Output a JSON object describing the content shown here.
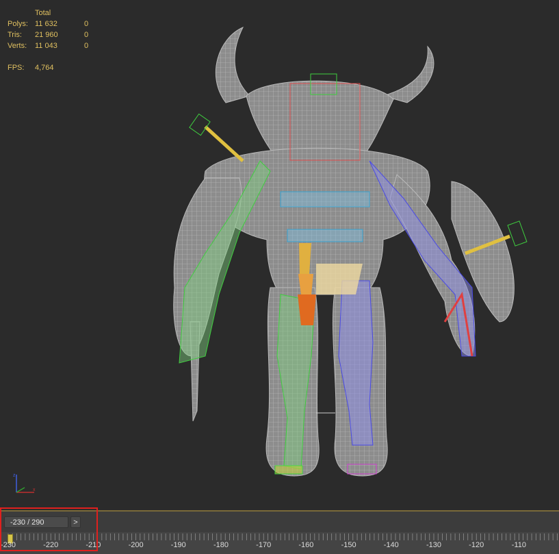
{
  "stats": {
    "header": "Total",
    "rows": [
      {
        "label": "Polys:",
        "total": "11 632",
        "selected": "0"
      },
      {
        "label": "Tris:",
        "total": "21 960",
        "selected": "0"
      },
      {
        "label": "Verts:",
        "total": "11 043",
        "selected": "0"
      }
    ],
    "fps_label": "FPS:",
    "fps_value": "4,764"
  },
  "timeline": {
    "frame_display": "-230 / 290",
    "next_label": ">",
    "tick_labels": [
      "-230",
      "-220",
      "-210",
      "-200",
      "-190",
      "-180",
      "-170",
      "-160",
      "-150",
      "-140",
      "-130",
      "-120",
      "-110"
    ],
    "current_frame": -230
  },
  "colors": {
    "viewport_bg": "#2b2b2b",
    "stats_text": "#e0c060",
    "highlight": "#e0201e",
    "time_slider": "#d7c64a"
  }
}
